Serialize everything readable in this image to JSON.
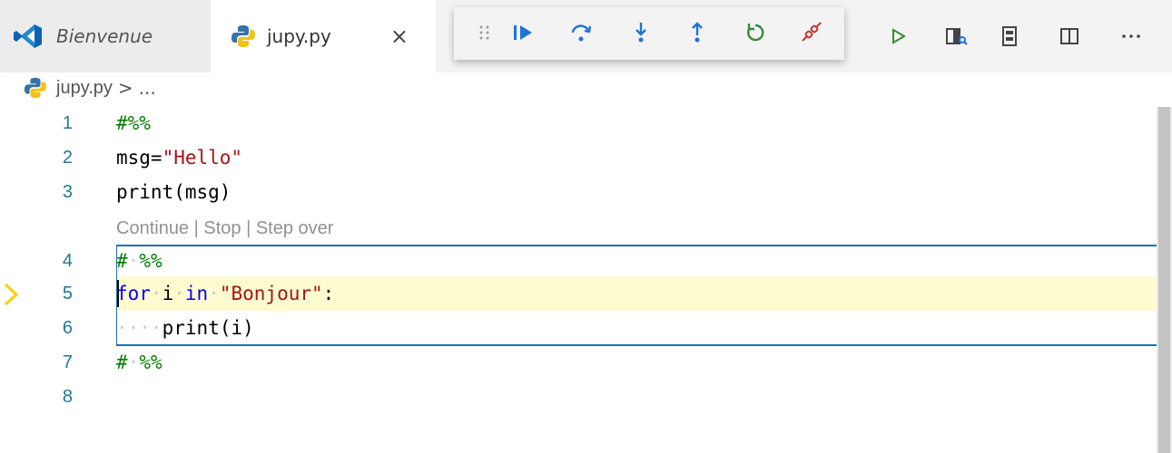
{
  "tabs": [
    {
      "label": "Bienvenue",
      "icon": "vscode-logo-icon"
    },
    {
      "label": "jupy.py",
      "icon": "python-file-icon",
      "close": "×"
    }
  ],
  "debug_toolbar": {
    "buttons": [
      "drag-handle",
      "continue",
      "step-over",
      "step-into",
      "step-out",
      "restart",
      "disconnect"
    ],
    "colors": {
      "blue": "#1f72d8",
      "green": "#388a34",
      "red": "#c5352a"
    }
  },
  "editor_actions": [
    "run",
    "open-preview-to-side",
    "show-notebook",
    "split-editor",
    "more"
  ],
  "breadcrumb": {
    "file": "jupy.py",
    "separator": ">",
    "rest": "..."
  },
  "codelens": "Continue | Stop | Step over",
  "lines": [
    {
      "num": "1",
      "text": "#%%"
    },
    {
      "num": "2",
      "text": "msg=\"Hello\""
    },
    {
      "num": "3",
      "text": "print(msg)"
    },
    {
      "num": "4",
      "text": "# %%"
    },
    {
      "num": "5",
      "text": "for i in \"Bonjour\":"
    },
    {
      "num": "6",
      "text": "    print(i)"
    },
    {
      "num": "7",
      "text": "# %%"
    },
    {
      "num": "8",
      "text": ""
    }
  ],
  "tokens": {
    "l1_comment": "#%%",
    "l2_a": "msg=",
    "l2_str": "\"Hello\"",
    "l3": "print(msg)",
    "hash": "#",
    "pct": "%%",
    "kw_for": "for",
    "var_i": "i",
    "kw_in": "in",
    "str_bonjour": "\"Bonjour\"",
    "colon": ":",
    "print_i": "print(i)",
    "dot": "·"
  }
}
